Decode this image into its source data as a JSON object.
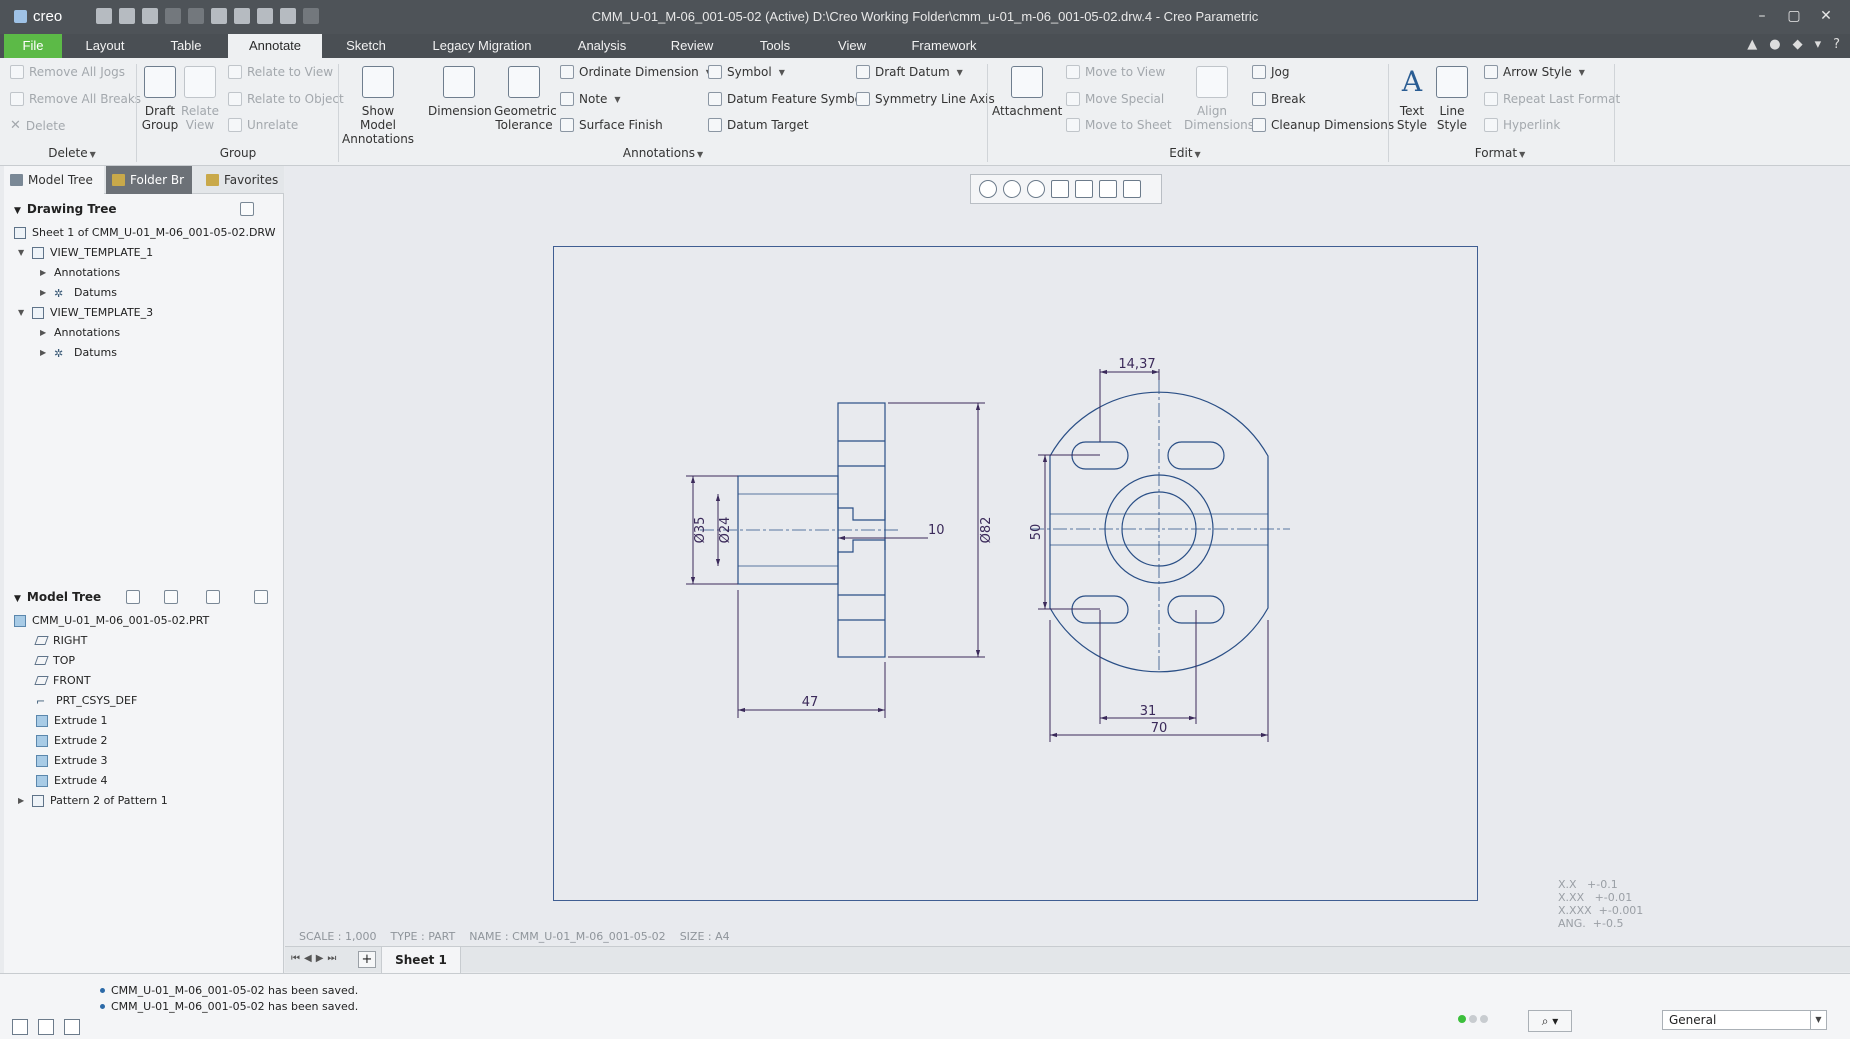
{
  "titlebar": {
    "logo": "creo",
    "title": "CMM_U-01_M-06_001-05-02 (Active) D:\\Creo Working Folder\\cmm_u-01_m-06_001-05-02.drw.4 - Creo Parametric",
    "minimize": "–",
    "maximize": "▢",
    "close": "✕"
  },
  "menu": {
    "tabs": [
      "File",
      "Layout",
      "Table",
      "Annotate",
      "Sketch",
      "Legacy Migration",
      "Analysis",
      "Review",
      "Tools",
      "View",
      "Framework"
    ],
    "active": "Annotate",
    "right_icons": [
      "▲",
      "●",
      "◆",
      "▾",
      "?"
    ]
  },
  "ribbon": {
    "delete_group": {
      "remove_all_jogs": "Remove All Jogs",
      "remove_all_breaks": "Remove All Breaks",
      "delete": "Delete",
      "label": "Delete"
    },
    "group_group": {
      "draft_group_line1": "Draft",
      "draft_group_line2": "Group",
      "relate_view_line1": "Relate",
      "relate_view_line2": "View",
      "relate_to_view": "Relate to View",
      "relate_to_object": "Relate to Object",
      "unrelate": "Unrelate",
      "label": "Group"
    },
    "annotations_group": {
      "show_model_line1": "Show Model",
      "show_model_line2": "Annotations",
      "dimension": "Dimension",
      "geom_tol_line1": "Geometric",
      "geom_tol_line2": "Tolerance",
      "ordinate_dimension": "Ordinate Dimension",
      "note": "Note",
      "surface_finish": "Surface Finish",
      "symbol": "Symbol",
      "datum_feature_symbol": "Datum Feature Symbol",
      "datum_target": "Datum Target",
      "draft_datum": "Draft Datum",
      "symmetry_line_axis": "Symmetry Line Axis",
      "label": "Annotations"
    },
    "edit_group": {
      "attachment": "Attachment",
      "move_to_view": "Move to View",
      "move_special": "Move Special",
      "move_to_sheet": "Move to Sheet",
      "align_line1": "Align",
      "align_line2": "Dimensions",
      "jog": "Jog",
      "break": "Break",
      "cleanup_dimensions": "Cleanup Dimensions",
      "label": "Edit"
    },
    "format_group": {
      "text_style_line1": "Text",
      "text_style_line2": "Style",
      "line_style_line1": "Line",
      "line_style_line2": "Style",
      "arrow_style": "Arrow Style",
      "repeat_last_format": "Repeat Last Format",
      "hyperlink": "Hyperlink",
      "label": "Format"
    }
  },
  "leftpanel": {
    "tabs": [
      "Model Tree",
      "Folder Br",
      "Favorites"
    ],
    "drawing_tree": {
      "title": "Drawing Tree",
      "rows": [
        {
          "label": "Sheet 1 of CMM_U-01_M-06_001-05-02.DRW"
        },
        {
          "label": "VIEW_TEMPLATE_1"
        },
        {
          "label": "Annotations"
        },
        {
          "label": "Datums"
        },
        {
          "label": "VIEW_TEMPLATE_3"
        },
        {
          "label": "Annotations"
        },
        {
          "label": "Datums"
        }
      ]
    },
    "model_tree": {
      "title": "Model Tree",
      "rows": [
        {
          "label": "CMM_U-01_M-06_001-05-02.PRT"
        },
        {
          "label": "RIGHT"
        },
        {
          "label": "TOP"
        },
        {
          "label": "FRONT"
        },
        {
          "label": "PRT_CSYS_DEF"
        },
        {
          "label": "Extrude 1"
        },
        {
          "label": "Extrude 2"
        },
        {
          "label": "Extrude 3"
        },
        {
          "label": "Extrude 4"
        },
        {
          "label": "Pattern 2 of Pattern 1"
        }
      ]
    }
  },
  "drawing": {
    "dims": {
      "d35": "Ø35",
      "d24": "Ø24",
      "d10": "10",
      "d82": "Ø82",
      "d47": "47",
      "d14": "14,37",
      "d50": "50",
      "d31": "31",
      "d70": "70"
    },
    "tolerances": [
      "X.X   +-0.1",
      "X.XX   +-0.01",
      "X.XXX  +-0.001",
      "ANG.  +-0.5"
    ],
    "status": {
      "scale": "SCALE : 1,000",
      "type": "TYPE : PART",
      "name": "NAME : CMM_U-01_M-06_001-05-02",
      "size": "SIZE : A4"
    }
  },
  "sheetbar": {
    "plus": "+",
    "sheet_tab": "Sheet 1"
  },
  "messages": [
    "CMM_U-01_M-06_001-05-02 has been saved.",
    "CMM_U-01_M-06_001-05-02 has been saved."
  ],
  "filter": {
    "value": "General"
  },
  "colors": {
    "accent_green": "#5cba47",
    "line_blue": "#2a4f86",
    "dim_purple": "#3b2a5a",
    "sheet_border": "#3f5e92"
  }
}
